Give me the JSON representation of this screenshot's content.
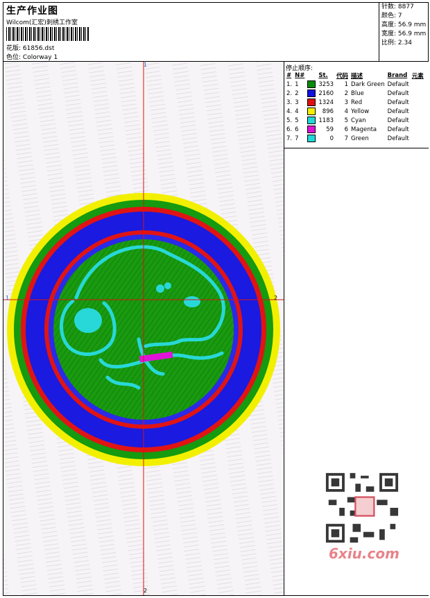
{
  "header": {
    "title": "生产作业图",
    "company": "Wilcom(汇宏)刺绣工作室",
    "design_label": "花版:",
    "design_file": "61856.dst",
    "colorway_label": "色位:",
    "colorway": "Colorway 1"
  },
  "stats": {
    "stitches": "针数: 8877",
    "colors": "颜色: 7",
    "height": "高度: 56.9 mm",
    "width": "宽度: 56.9 mm",
    "scale": "比例: 2.34"
  },
  "axes": {
    "top": "1",
    "bottom": "2",
    "left": "1",
    "right": "2"
  },
  "stop_sequence": {
    "title": "停止顺序:",
    "columns": [
      "#",
      "N#",
      "St.",
      "代码",
      "描述",
      "Brand",
      "元素"
    ],
    "rows": [
      {
        "idx": "1.",
        "n": "1",
        "color": "#0a8a0a",
        "st": "3253",
        "code": "1",
        "desc": "Dark Green",
        "brand": "Default"
      },
      {
        "idx": "2.",
        "n": "2",
        "color": "#1010e0",
        "st": "2160",
        "code": "2",
        "desc": "Blue",
        "brand": "Default"
      },
      {
        "idx": "3.",
        "n": "3",
        "color": "#e01010",
        "st": "1324",
        "code": "3",
        "desc": "Red",
        "brand": "Default"
      },
      {
        "idx": "4.",
        "n": "4",
        "color": "#f0f000",
        "st": "896",
        "code": "4",
        "desc": "Yellow",
        "brand": "Default"
      },
      {
        "idx": "5.",
        "n": "5",
        "color": "#20d8d8",
        "st": "1183",
        "code": "5",
        "desc": "Cyan",
        "brand": "Default"
      },
      {
        "idx": "6.",
        "n": "6",
        "color": "#e010d8",
        "st": "59",
        "code": "6",
        "desc": "Magenta",
        "brand": "Default"
      },
      {
        "idx": "7.",
        "n": "7",
        "color": "#20d8d8",
        "st": "0",
        "code": "7",
        "desc": "Green",
        "brand": "Default"
      }
    ]
  },
  "watermark": "6xiu.com"
}
